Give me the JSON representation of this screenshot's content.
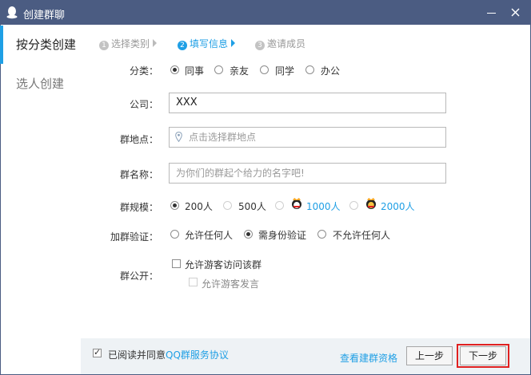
{
  "window": {
    "title": "创建群聊"
  },
  "sidebar": {
    "items": [
      {
        "label": "按分类创建"
      },
      {
        "label": "选人创建"
      }
    ]
  },
  "steps": [
    {
      "num": "1",
      "label": "选择类别"
    },
    {
      "num": "2",
      "label": "填写信息"
    },
    {
      "num": "3",
      "label": "邀请成员"
    }
  ],
  "form": {
    "category": {
      "label": "分类：",
      "options": [
        "同事",
        "亲友",
        "同学",
        "办公"
      ],
      "selected": "同事"
    },
    "company": {
      "label": "公司：",
      "value": "XXX"
    },
    "location": {
      "label": "群地点：",
      "placeholder": "点击选择群地点"
    },
    "name": {
      "label": "群名称：",
      "placeholder": "为你们的群起个给力的名字吧!"
    },
    "size": {
      "label": "群规模：",
      "options": [
        "200人",
        "500人",
        "1000人",
        "2000人"
      ],
      "selected": "200人"
    },
    "verify": {
      "label": "加群验证：",
      "options": [
        "允许任何人",
        "需身份验证",
        "不允许任何人"
      ],
      "selected": "需身份验证"
    },
    "public": {
      "label": "群公开：",
      "allow_visitor": "允许游客访问该群",
      "allow_visitor_speak": "允许游客发言"
    }
  },
  "footer": {
    "agree_text": "已阅读并同意",
    "agree_link": "QQ群服务协议",
    "qualification": "查看建群资格",
    "prev": "上一步",
    "next": "下一步"
  },
  "colors": {
    "titlebar": "#4b5c82",
    "accent": "#1f9fe5",
    "highlight": "#e02020"
  }
}
